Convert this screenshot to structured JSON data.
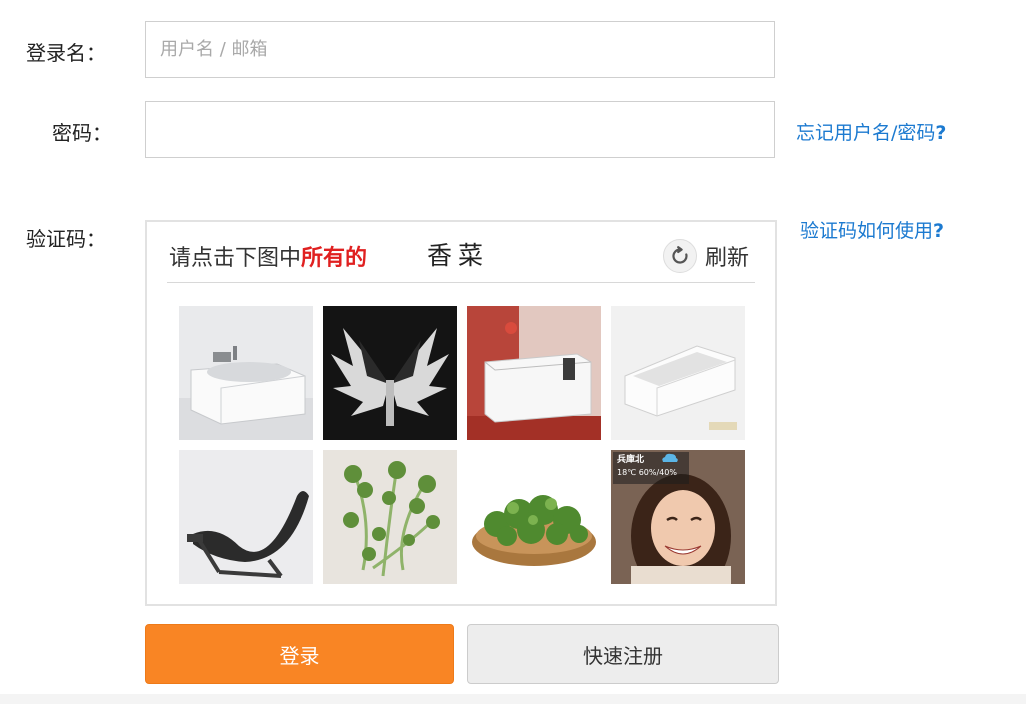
{
  "form": {
    "username_label": "登录名：",
    "username_placeholder": "用户名 / 邮箱",
    "username_value": "",
    "password_label": "密码：",
    "password_value": "",
    "captcha_label": "验证码："
  },
  "links": {
    "forgot": "忘记用户名/密码",
    "forgot_q": "?",
    "captcha_help": "验证码如何使用",
    "captcha_help_q": "?"
  },
  "captcha": {
    "instruction_prefix": "请点击下图中",
    "instruction_emphasis": "所有的",
    "target_word": "香菜",
    "refresh_label": "刷新",
    "refresh_icon": "refresh-icon",
    "tiles": [
      {
        "subject": "bathtub-image"
      },
      {
        "subject": "wings-image"
      },
      {
        "subject": "bathtub-image"
      },
      {
        "subject": "bathtub-image"
      },
      {
        "subject": "lounge-chair-image"
      },
      {
        "subject": "coriander-image"
      },
      {
        "subject": "coriander-basket-image"
      },
      {
        "subject": "tv-woman-image",
        "overlay_lines": [
          "兵庫北",
          "18℃ 60%/40%"
        ]
      }
    ]
  },
  "buttons": {
    "login": "登录",
    "register": "快速注册"
  },
  "colors": {
    "link": "#1c7ad0",
    "login_button": "#f98524",
    "emphasis": "#e02020"
  }
}
